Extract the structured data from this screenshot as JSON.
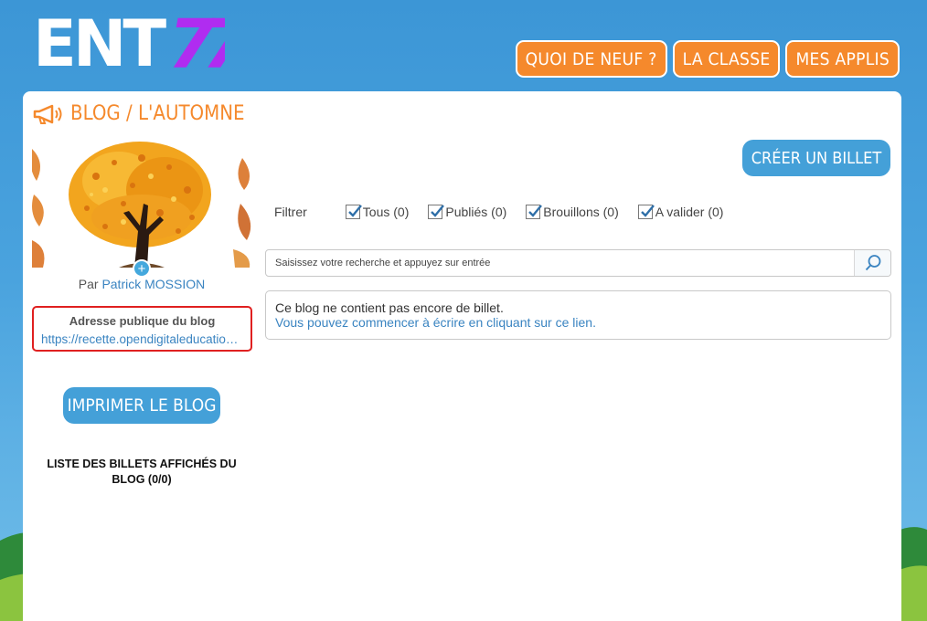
{
  "logo": {
    "text": "ENT",
    "accent_text": "77",
    "colors": {
      "main": "#ffffff",
      "accent": "#b02cf0"
    }
  },
  "topnav": {
    "items": [
      {
        "label": "QUOI DE NEUF ?"
      },
      {
        "label": "LA CLASSE"
      },
      {
        "label": "MES APPLIS"
      }
    ]
  },
  "page": {
    "title": "BLOG / L'AUTOMNE",
    "icon": "megaphone-icon"
  },
  "sidebar": {
    "author_prefix": "Par",
    "author_name": "Patrick MOSSION",
    "add_image_symbol": "+",
    "public_address_title": "Adresse publique du blog",
    "public_address_url": "https://recette.opendigitaleducation.com/blog/pub/l-automne",
    "print_button": "IMPRIMER LE BLOG",
    "list_title": "LISTE DES BILLETS AFFICHÉS DU BLOG (0/0)"
  },
  "main": {
    "create_button": "CRÉER UN BILLET",
    "filter_label": "Filtrer",
    "filters": [
      {
        "label": "Tous (0)",
        "checked": true
      },
      {
        "label": "Publiés (0)",
        "checked": true
      },
      {
        "label": "Brouillons (0)",
        "checked": true
      },
      {
        "label": "A valider (0)",
        "checked": true
      }
    ],
    "search_placeholder": "Saisissez votre recherche et appuyez sur entrée",
    "empty_message": "Ce blog ne contient pas encore de billet.",
    "empty_link": "Vous pouvez commencer à écrire en cliquant sur ce lien."
  },
  "colors": {
    "orange": "#f5892c",
    "blue": "#44a0d8",
    "link": "#3a84c1",
    "highlight": "#e02020"
  }
}
